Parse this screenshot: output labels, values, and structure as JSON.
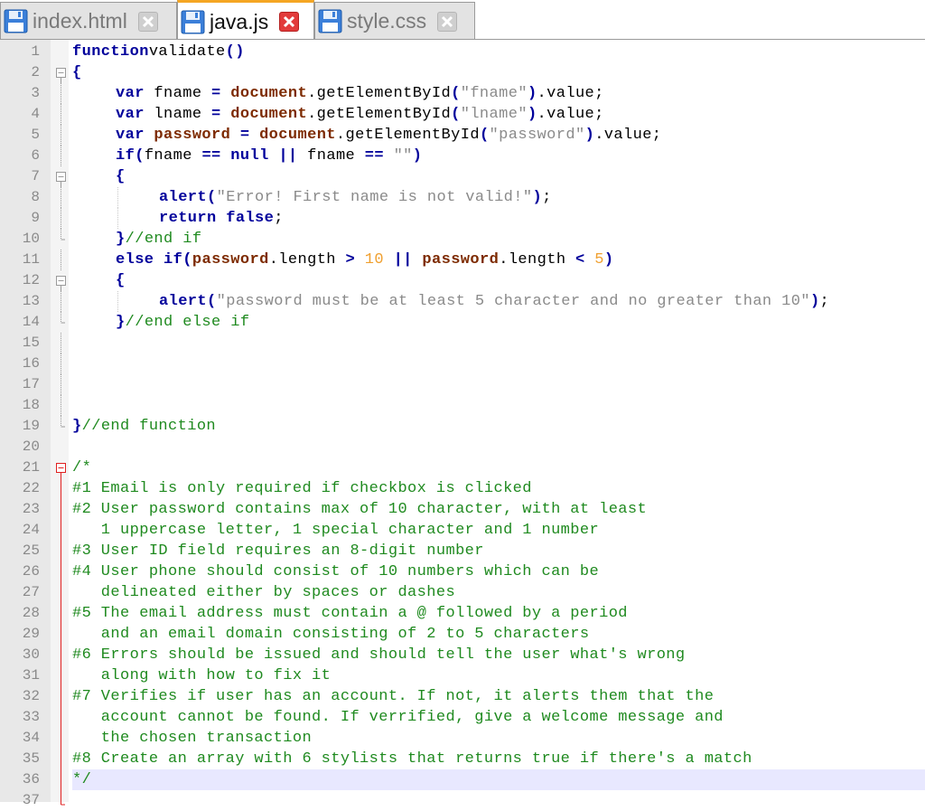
{
  "tabs": [
    {
      "label": "index.html",
      "active": false,
      "icon": "floppy-disk-icon"
    },
    {
      "label": "java.js",
      "active": true,
      "icon": "floppy-disk-icon"
    },
    {
      "label": "style.css",
      "active": false,
      "icon": "floppy-disk-icon"
    }
  ],
  "colors": {
    "keyword": "#00009b",
    "object": "#7d2a00",
    "string": "#8a8a8a",
    "number": "#f0a030",
    "comment": "#1f8a1f",
    "active_tab_accent": "#f5a623",
    "close_active": "#e23b3b",
    "current_line": "#e8e8ff"
  },
  "editor": {
    "current_line": 36,
    "lines": [
      {
        "n": "1",
        "fold": "",
        "indent": 0,
        "seg": [
          [
            "kw",
            "function"
          ],
          [
            "",
            "validate"
          ],
          [
            "op",
            "()"
          ]
        ]
      },
      {
        "n": "2",
        "fold": "open",
        "indent": 0,
        "seg": [
          [
            "op",
            "{"
          ]
        ]
      },
      {
        "n": "3",
        "fold": "bar",
        "indent": 1,
        "seg": [
          [
            "kw",
            "var"
          ],
          [
            "",
            " fname "
          ],
          [
            "op",
            "="
          ],
          [
            "",
            " "
          ],
          [
            "obj",
            "document"
          ],
          [
            "",
            ".getElementById"
          ],
          [
            "op",
            "("
          ],
          [
            "str",
            "\"fname\""
          ],
          [
            "op",
            ")"
          ],
          [
            "",
            ".value;"
          ]
        ]
      },
      {
        "n": "4",
        "fold": "bar",
        "indent": 1,
        "seg": [
          [
            "kw",
            "var"
          ],
          [
            "",
            " lname "
          ],
          [
            "op",
            "="
          ],
          [
            "",
            " "
          ],
          [
            "obj",
            "document"
          ],
          [
            "",
            ".getElementById"
          ],
          [
            "op",
            "("
          ],
          [
            "str",
            "\"lname\""
          ],
          [
            "op",
            ")"
          ],
          [
            "",
            ".value;"
          ]
        ]
      },
      {
        "n": "5",
        "fold": "bar",
        "indent": 1,
        "seg": [
          [
            "kw",
            "var"
          ],
          [
            "",
            " "
          ],
          [
            "obj",
            "password"
          ],
          [
            "",
            " "
          ],
          [
            "op",
            "="
          ],
          [
            "",
            " "
          ],
          [
            "obj",
            "document"
          ],
          [
            "",
            ".getElementById"
          ],
          [
            "op",
            "("
          ],
          [
            "str",
            "\"password\""
          ],
          [
            "op",
            ")"
          ],
          [
            "",
            ".value;"
          ]
        ]
      },
      {
        "n": "6",
        "fold": "bar",
        "indent": 1,
        "seg": [
          [
            "kw",
            "if"
          ],
          [
            "op",
            "("
          ],
          [
            "",
            "fname "
          ],
          [
            "op",
            "=="
          ],
          [
            "",
            " "
          ],
          [
            "kw",
            "null"
          ],
          [
            "",
            " "
          ],
          [
            "op",
            "||"
          ],
          [
            "",
            " fname "
          ],
          [
            "op",
            "=="
          ],
          [
            "",
            " "
          ],
          [
            "str",
            "\"\""
          ],
          [
            "op",
            ")"
          ]
        ]
      },
      {
        "n": "7",
        "fold": "open",
        "indent": 1,
        "seg": [
          [
            "op",
            "{"
          ]
        ]
      },
      {
        "n": "8",
        "fold": "bar",
        "indent": 2,
        "seg": [
          [
            "kw",
            "alert"
          ],
          [
            "op",
            "("
          ],
          [
            "str",
            "\"Error! First name is not valid!\""
          ],
          [
            "op",
            ")"
          ],
          [
            "",
            ";"
          ]
        ]
      },
      {
        "n": "9",
        "fold": "bar",
        "indent": 2,
        "seg": [
          [
            "kw",
            "return"
          ],
          [
            "",
            " "
          ],
          [
            "kw",
            "false"
          ],
          [
            "",
            ";"
          ]
        ]
      },
      {
        "n": "10",
        "fold": "end",
        "indent": 1,
        "seg": [
          [
            "op",
            "}"
          ],
          [
            "cm",
            "//end if"
          ]
        ]
      },
      {
        "n": "11",
        "fold": "bar",
        "indent": 1,
        "seg": [
          [
            "kw",
            "else"
          ],
          [
            "",
            " "
          ],
          [
            "kw",
            "if"
          ],
          [
            "op",
            "("
          ],
          [
            "obj",
            "password"
          ],
          [
            "",
            ".length "
          ],
          [
            "op",
            ">"
          ],
          [
            "",
            " "
          ],
          [
            "num",
            "10"
          ],
          [
            "",
            " "
          ],
          [
            "op",
            "||"
          ],
          [
            "",
            " "
          ],
          [
            "obj",
            "password"
          ],
          [
            "",
            ".length "
          ],
          [
            "op",
            "<"
          ],
          [
            "",
            " "
          ],
          [
            "num",
            "5"
          ],
          [
            "op",
            ")"
          ]
        ]
      },
      {
        "n": "12",
        "fold": "open",
        "indent": 1,
        "seg": [
          [
            "op",
            "{"
          ]
        ]
      },
      {
        "n": "13",
        "fold": "bar",
        "indent": 2,
        "seg": [
          [
            "kw",
            "alert"
          ],
          [
            "op",
            "("
          ],
          [
            "str",
            "\"password must be at least 5 character and no greater than 10\""
          ],
          [
            "op",
            ")"
          ],
          [
            "",
            ";"
          ]
        ]
      },
      {
        "n": "14",
        "fold": "end",
        "indent": 1,
        "seg": [
          [
            "op",
            "}"
          ],
          [
            "cm",
            "//end else if"
          ]
        ]
      },
      {
        "n": "15",
        "fold": "bar",
        "indent": 0,
        "seg": []
      },
      {
        "n": "16",
        "fold": "bar",
        "indent": 0,
        "seg": []
      },
      {
        "n": "17",
        "fold": "bar",
        "indent": 0,
        "seg": []
      },
      {
        "n": "18",
        "fold": "bar",
        "indent": 0,
        "seg": []
      },
      {
        "n": "19",
        "fold": "end",
        "indent": 0,
        "seg": [
          [
            "op",
            "}"
          ],
          [
            "cm",
            "//end function"
          ]
        ]
      },
      {
        "n": "20",
        "fold": "",
        "indent": 0,
        "seg": []
      },
      {
        "n": "21",
        "fold": "open-red",
        "indent": 0,
        "seg": [
          [
            "cm",
            "/*"
          ]
        ]
      },
      {
        "n": "22",
        "fold": "red",
        "indent": 0,
        "seg": [
          [
            "cm",
            "#1 Email is only required if checkbox is clicked"
          ]
        ]
      },
      {
        "n": "23",
        "fold": "red",
        "indent": 0,
        "seg": [
          [
            "cm",
            "#2 User password contains max of 10 character, with at least"
          ]
        ]
      },
      {
        "n": "24",
        "fold": "red",
        "indent": 0,
        "seg": [
          [
            "cm",
            "   1 uppercase letter, 1 special character and 1 number"
          ]
        ]
      },
      {
        "n": "25",
        "fold": "red",
        "indent": 0,
        "seg": [
          [
            "cm",
            "#3 User ID field requires an 8-digit number"
          ]
        ]
      },
      {
        "n": "26",
        "fold": "red",
        "indent": 0,
        "seg": [
          [
            "cm",
            "#4 User phone should consist of 10 numbers which can be"
          ]
        ]
      },
      {
        "n": "27",
        "fold": "red",
        "indent": 0,
        "seg": [
          [
            "cm",
            "   delineated either by spaces or dashes"
          ]
        ]
      },
      {
        "n": "28",
        "fold": "red",
        "indent": 0,
        "seg": [
          [
            "cm",
            "#5 The email address must contain a @ followed by a period"
          ]
        ]
      },
      {
        "n": "29",
        "fold": "red",
        "indent": 0,
        "seg": [
          [
            "cm",
            "   and an email domain consisting of 2 to 5 characters"
          ]
        ]
      },
      {
        "n": "30",
        "fold": "red",
        "indent": 0,
        "seg": [
          [
            "cm",
            "#6 Errors should be issued and should tell the user what's wrong"
          ]
        ]
      },
      {
        "n": "31",
        "fold": "red",
        "indent": 0,
        "seg": [
          [
            "cm",
            "   along with how to fix it"
          ]
        ]
      },
      {
        "n": "32",
        "fold": "red",
        "indent": 0,
        "seg": [
          [
            "cm",
            "#7 Verifies if user has an account. If not, it alerts them that the"
          ]
        ]
      },
      {
        "n": "33",
        "fold": "red",
        "indent": 0,
        "seg": [
          [
            "cm",
            "   account cannot be found. If verrified, give a welcome message and"
          ]
        ]
      },
      {
        "n": "34",
        "fold": "red",
        "indent": 0,
        "seg": [
          [
            "cm",
            "   the chosen transaction"
          ]
        ]
      },
      {
        "n": "35",
        "fold": "red",
        "indent": 0,
        "seg": [
          [
            "cm",
            "#8 Create an array with 6 stylists that returns true if there's a match"
          ]
        ]
      },
      {
        "n": "36",
        "fold": "red",
        "indent": 0,
        "seg": [
          [
            "cm",
            "*/"
          ]
        ]
      },
      {
        "n": "37",
        "fold": "red-end",
        "indent": 0,
        "seg": []
      }
    ]
  }
}
